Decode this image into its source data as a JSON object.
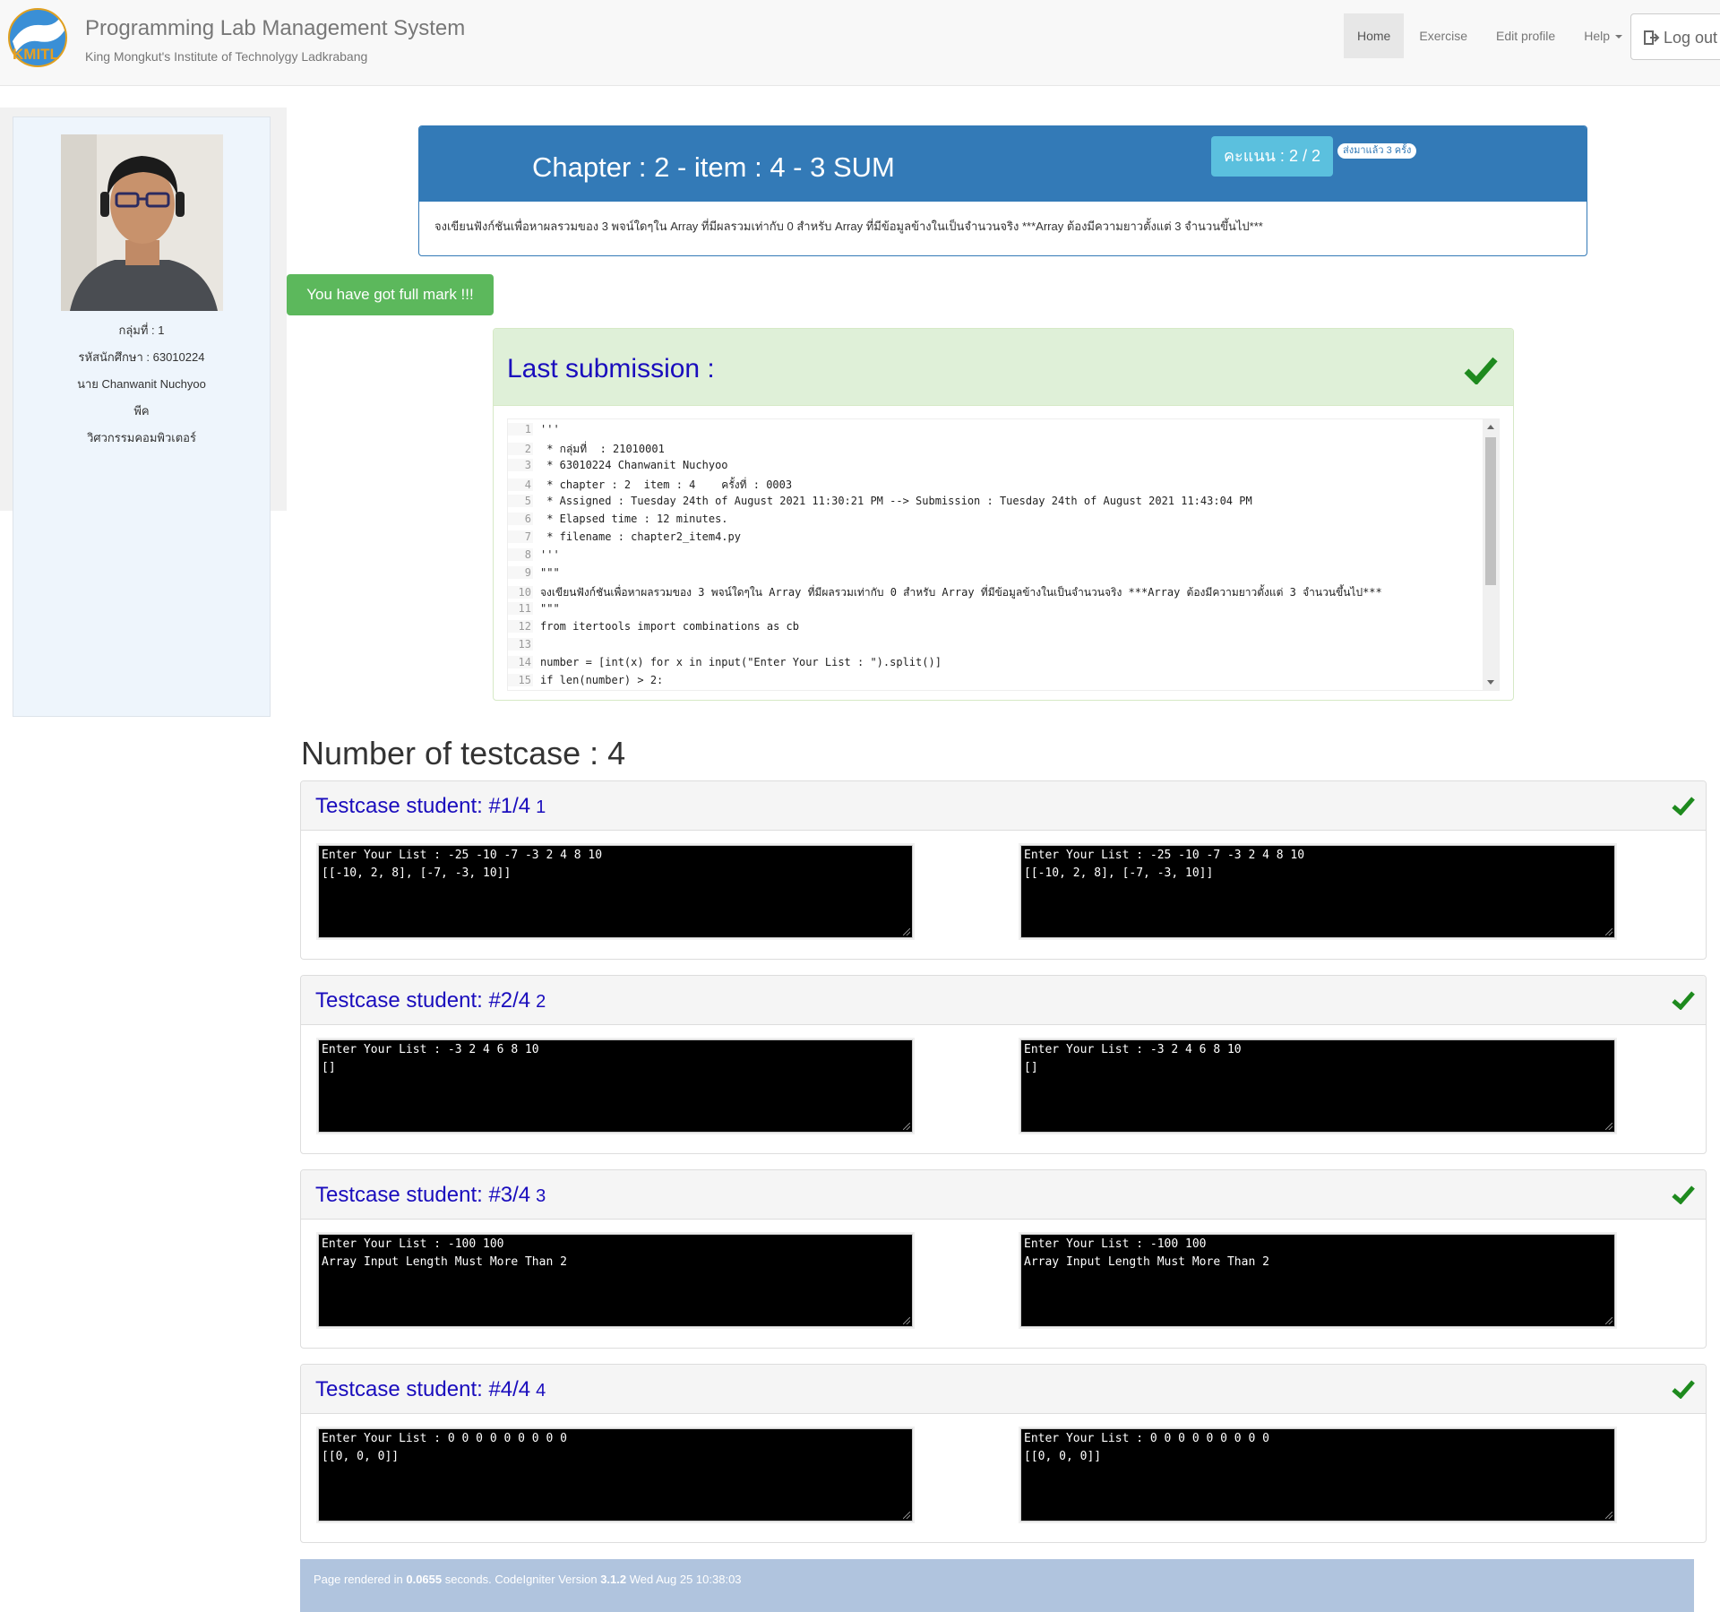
{
  "header": {
    "title": "Programming Lab Management System",
    "subtitle": "King Mongkut's Institute of Technolygy Ladkrabang",
    "logo_text": "KMITL",
    "nav": [
      {
        "label": "Home",
        "active": true
      },
      {
        "label": "Exercise",
        "active": false
      },
      {
        "label": "Edit profile",
        "active": false
      },
      {
        "label": "Help",
        "active": false
      }
    ],
    "logout_label": "Log out"
  },
  "student": {
    "group": "กลุ่มที่ : 1",
    "student_id": "รหัสนักศึกษา : 63010224",
    "name": "นาย Chanwanit Nuchyoo",
    "nickname": "พีค",
    "department": "วิศวกรรมคอมพิวเตอร์"
  },
  "exercise": {
    "title": "Chapter : 2 - item : 4 - 3 SUM",
    "score": "คะแนน : 2 / 2",
    "sent_badge": "ส่งมาแล้ว 3 ครั้ง",
    "description": "จงเขียนฟังก์ชันเพื่อหาผลรวมของ 3 พจน์ใดๆใน Array ที่มีผลรวมเท่ากับ 0 สำหรับ Array ที่มีข้อมูลข้างในเป็นจำนวนจริง ***Array ต้องมีความยาวตั้งแต่ 3 จำนวนขึ้นไป***"
  },
  "alert": "You have got full mark !!!",
  "submission": {
    "title": "Last submission :",
    "code_lines": [
      {
        "n": "1",
        "text": "'''"
      },
      {
        "n": "2",
        "text": " * กลุ่มที่  : 21010001"
      },
      {
        "n": "3",
        "text": " * 63010224 Chanwanit Nuchyoo"
      },
      {
        "n": "4",
        "text": " * chapter : 2  item : 4    ครั้งที่ : 0003"
      },
      {
        "n": "5",
        "text": " * Assigned : Tuesday 24th of August 2021 11:30:21 PM --> Submission : Tuesday 24th of August 2021 11:43:04 PM"
      },
      {
        "n": "6",
        "text": " * Elapsed time : 12 minutes."
      },
      {
        "n": "7",
        "text": " * filename : chapter2_item4.py"
      },
      {
        "n": "8",
        "text": "'''"
      },
      {
        "n": "9",
        "text": "\"\"\""
      },
      {
        "n": "10",
        "text": "จงเขียนฟังก์ชันเพื่อหาผลรวมของ 3 พจน์ใดๆใน Array ที่มีผลรวมเท่ากับ 0 สำหรับ Array ที่มีข้อมูลข้างในเป็นจำนวนจริง ***Array ต้องมีความยาวตั้งแต่ 3 จำนวนขึ้นไป***"
      },
      {
        "n": "11",
        "text": "\"\"\""
      },
      {
        "n": "12",
        "text": "from itertools import combinations as cb"
      },
      {
        "n": "13",
        "text": ""
      },
      {
        "n": "14",
        "text": "number = [int(x) for x in input(\"Enter Your List : \").split()]"
      },
      {
        "n": "15",
        "text": "if len(number) > 2:"
      }
    ]
  },
  "testcases": {
    "heading": "Number of testcase : 4",
    "items": [
      {
        "title": "Testcase student: #1/4",
        "num": "1",
        "student": [
          "Enter Your List : -25 -10 -7 -3 2 4 8 10",
          "[[-10, 2, 8], [-7, -3, 10]]"
        ],
        "expected": [
          "Enter Your List : -25 -10 -7 -3 2 4 8 10",
          "[[-10, 2, 8], [-7, -3, 10]]"
        ]
      },
      {
        "title": "Testcase student: #2/4",
        "num": "2",
        "student": [
          "Enter Your List : -3 2 4 6 8 10",
          "[]"
        ],
        "expected": [
          "Enter Your List : -3 2 4 6 8 10",
          "[]"
        ]
      },
      {
        "title": "Testcase student: #3/4",
        "num": "3",
        "student": [
          "Enter Your List : -100 100",
          "Array Input Length Must More Than 2"
        ],
        "expected": [
          "Enter Your List : -100 100",
          "Array Input Length Must More Than 2"
        ]
      },
      {
        "title": "Testcase student: #4/4",
        "num": "4",
        "student": [
          "Enter Your List : 0 0 0 0 0 0 0 0 0",
          "[[0, 0, 0]]"
        ],
        "expected": [
          "Enter Your List : 0 0 0 0 0 0 0 0 0",
          "[[0, 0, 0]]"
        ]
      }
    ]
  },
  "footer": {
    "prefix": "Page rendered in ",
    "time": "0.0655",
    "middle": " seconds. CodeIgniter Version ",
    "version": "3.1.2",
    "suffix": " Wed Aug 25 10:38:03"
  },
  "colors": {
    "primary": "#337ab7",
    "success": "#5cb85c",
    "info": "#5bc0de",
    "link_blue": "#1a0dbd",
    "check_green": "#1e8a1e"
  }
}
